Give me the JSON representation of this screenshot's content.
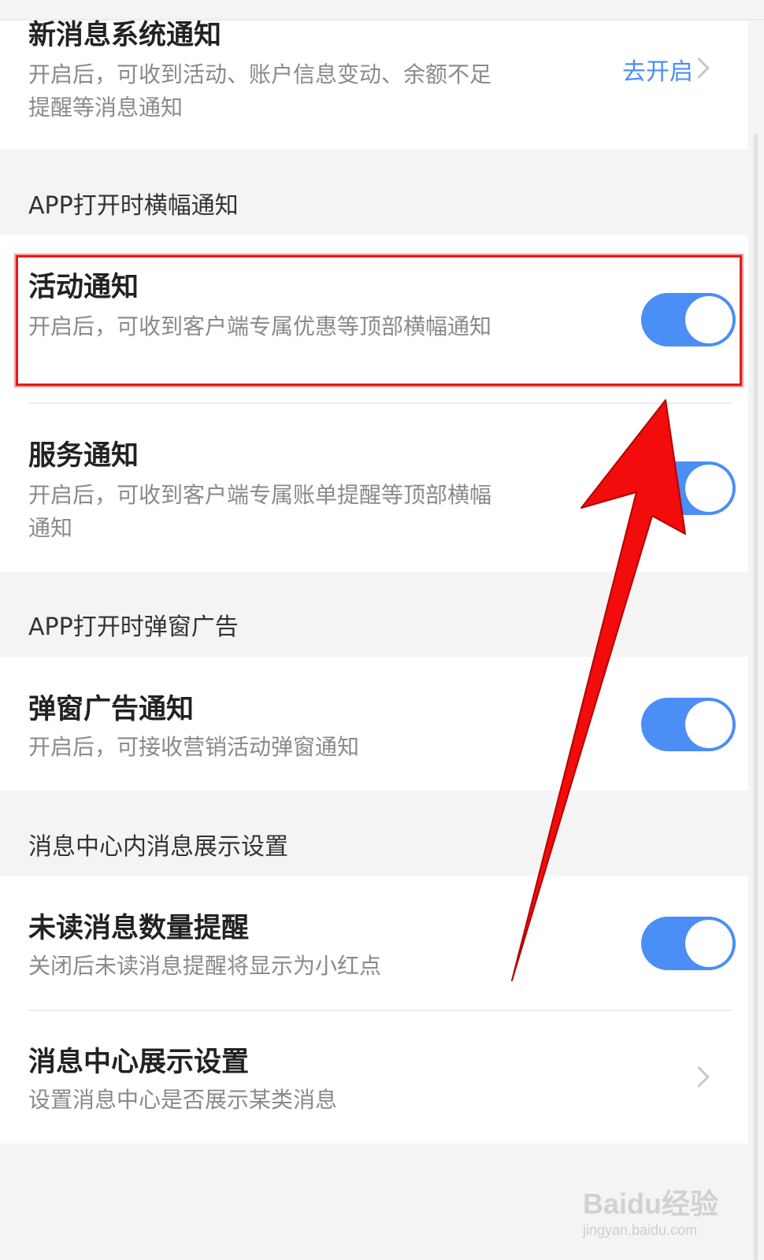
{
  "colors": {
    "accent": "#4b8ef5",
    "annotation": "#e31b1b"
  },
  "top_item": {
    "title": "新消息系统通知",
    "desc": "开启后，可收到活动、账户信息变动、余额不足提醒等消息通知",
    "link": "去开启"
  },
  "section_banner": {
    "header": "APP打开时横幅通知",
    "items": [
      {
        "title": "活动通知",
        "desc": "开启后，可收到客户端专属优惠等顶部横幅通知",
        "enabled": true
      },
      {
        "title": "服务通知",
        "desc": "开启后，可收到客户端专属账单提醒等顶部横幅通知",
        "enabled": true
      }
    ]
  },
  "section_popup": {
    "header": "APP打开时弹窗广告",
    "items": [
      {
        "title": "弹窗广告通知",
        "desc": "开启后，可接收营销活动弹窗通知",
        "enabled": true
      }
    ]
  },
  "section_center": {
    "header": "消息中心内消息展示设置",
    "items": [
      {
        "title": "未读消息数量提醒",
        "desc": "关闭后未读消息提醒将显示为小红点",
        "enabled": true
      },
      {
        "title": "消息中心展示设置",
        "desc": "设置消息中心是否展示某类消息"
      }
    ]
  },
  "watermark": {
    "logo": "Baidu经验",
    "url": "jingyan.baidu.com"
  }
}
